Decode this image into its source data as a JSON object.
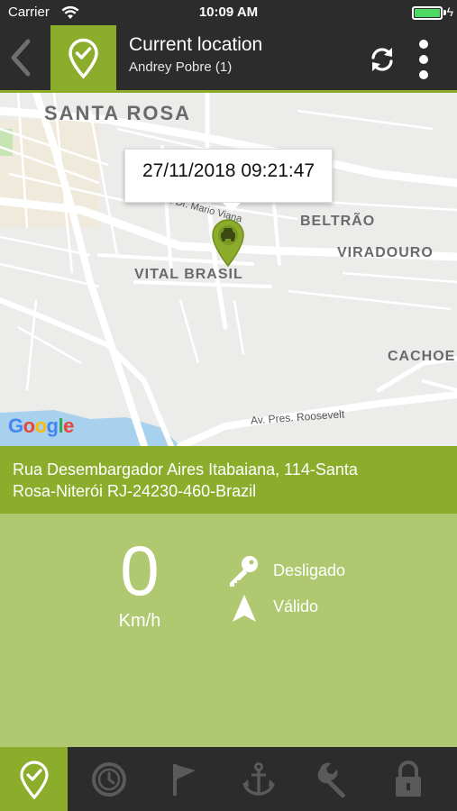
{
  "status_bar": {
    "carrier": "Carrier",
    "time": "10:09 AM",
    "battery_level": 1.0
  },
  "header": {
    "title": "Current location",
    "subtitle": "Andrey Pobre (1)",
    "icons": [
      "back-icon",
      "location-check-icon",
      "refresh-icon",
      "more-vert-icon"
    ]
  },
  "map": {
    "labels": {
      "santa_rosa": "SANTA ROSA",
      "beltrao": "BELTRÃO",
      "viradouro": "VIRADOURO",
      "vital_brasil": "VITAL BRASIL",
      "cachoe": "CACHOE",
      "street_mario": "R. Dr. Mario Viana",
      "roosevelt": "Av. Pres. Roosevelt"
    },
    "attribution": "Google",
    "marker_timestamp": "27/11/2018 09:21:47"
  },
  "address": {
    "line1": "Rua Desembargador Aires Itabaiana, 114-Santa",
    "line2": "Rosa-Niterói RJ-24230-460-Brazil"
  },
  "vehicle": {
    "speed": "0",
    "speed_unit": "Km/h",
    "ignition_status": "Desligado",
    "gps_status": "Válido"
  },
  "tabbar": {
    "items": [
      "current-location",
      "history",
      "flag",
      "anchor",
      "wrench",
      "lock"
    ],
    "active": "current-location"
  },
  "colors": {
    "accent": "#8cac2c",
    "panel": "#b0c870",
    "dark": "#2c2c2c",
    "map_bg": "#ececea"
  }
}
